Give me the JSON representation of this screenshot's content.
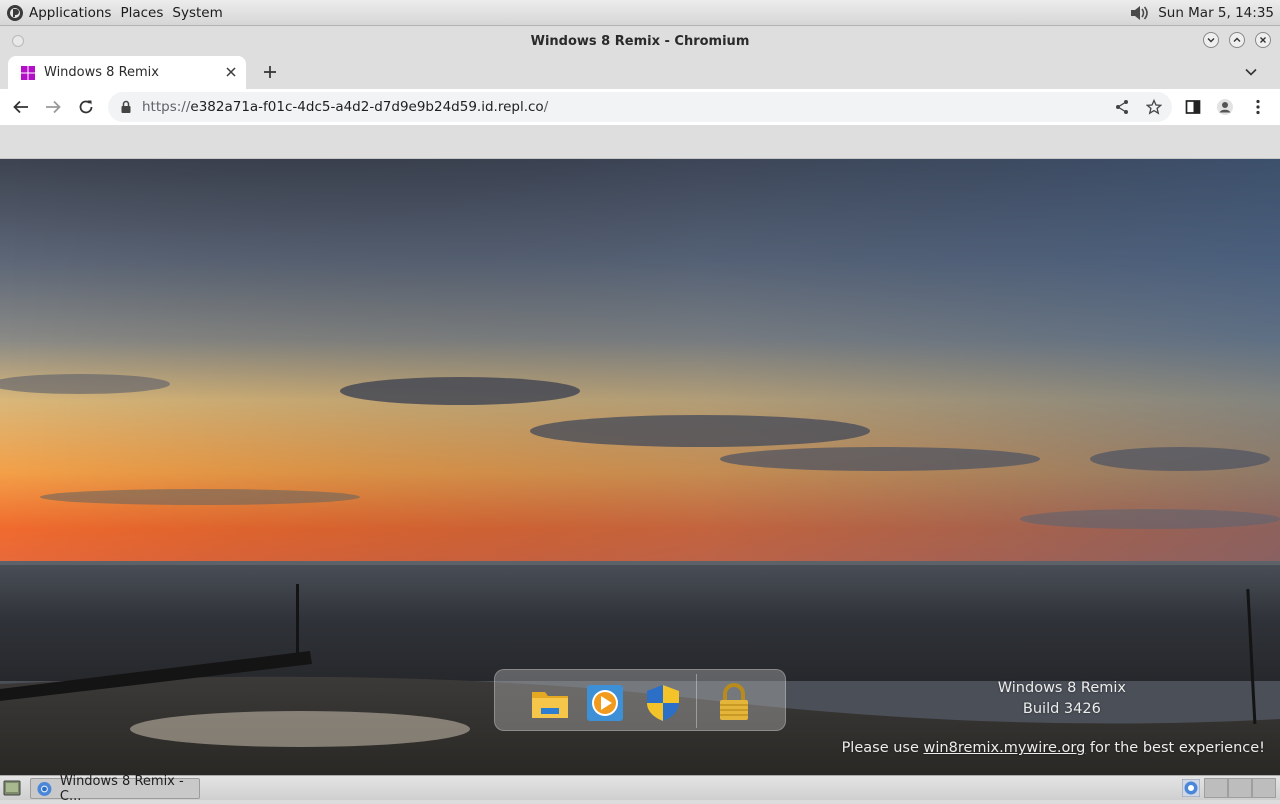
{
  "top_panel": {
    "menus": [
      "Applications",
      "Places",
      "System"
    ],
    "clock": "Sun Mar  5, 14:35"
  },
  "window": {
    "title": "Windows 8 Remix - Chromium"
  },
  "tab": {
    "title": "Windows 8 Remix"
  },
  "omnibox": {
    "scheme": "https://",
    "host": "e382a71a-f01c-4dc5-a4d2-d7d9e9b24d59.id.repl.co",
    "path": "/"
  },
  "dock": {
    "icons": [
      "file-explorer-icon",
      "media-player-icon",
      "security-shield-icon",
      "lock-icon"
    ]
  },
  "desktop": {
    "watermark_line1": "Windows 8 Remix",
    "watermark_line2": "Build 3426",
    "notice_before": "Please use ",
    "notice_link": "win8remix.mywire.org",
    "notice_after": " for the best experience!"
  },
  "taskbar": {
    "item_label": "Windows 8 Remix - C..."
  },
  "colors": {
    "accent_tab_favicon": "#b40fc8",
    "panel": "#dcdcdc"
  }
}
